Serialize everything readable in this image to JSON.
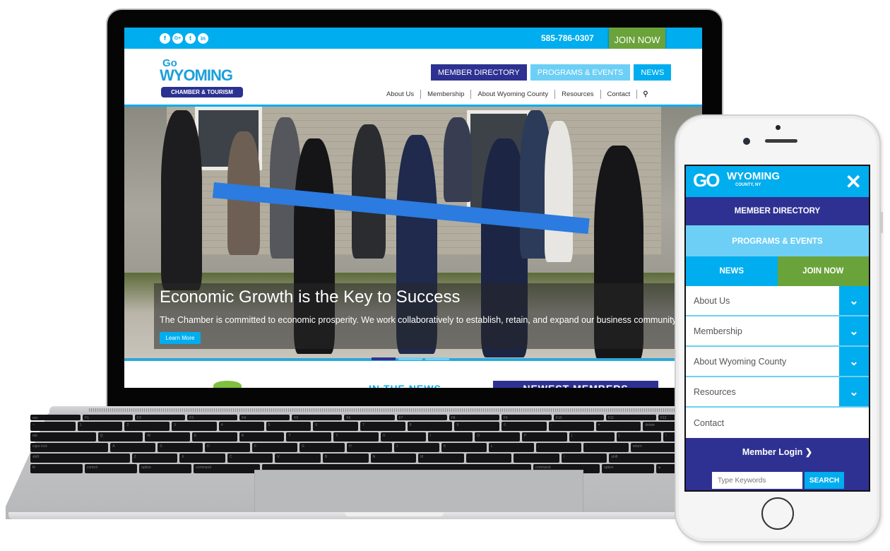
{
  "desktop": {
    "topbar": {
      "social": [
        {
          "icon": "facebook-icon",
          "glyph": "f"
        },
        {
          "icon": "google-plus-icon",
          "glyph": "G+"
        },
        {
          "icon": "twitter-icon",
          "glyph": "t"
        },
        {
          "icon": "linkedin-icon",
          "glyph": "in"
        }
      ],
      "phone": "585-786-0307",
      "join_label": "JOIN NOW"
    },
    "logo": {
      "go": "Go",
      "wyoming": "WYOMING",
      "tagline": "CHAMBER & TOURISM"
    },
    "pill_nav": [
      "MEMBER DIRECTORY",
      "PROGRAMS & EVENTS",
      "NEWS"
    ],
    "main_nav": [
      "About Us",
      "Membership",
      "About Wyoming County",
      "Resources",
      "Contact"
    ],
    "search_icon": "⚲",
    "hero": {
      "title": "Economic Growth is the Key to Success",
      "text": "The Chamber is committed to economic prosperity. We work collaboratively to establish, retain, and expand our business community",
      "button": "Learn More",
      "active_slide": 1,
      "slide_count": 3
    },
    "lower": {
      "news_heading": "IN THE NEWS",
      "members_heading": "NEWEST MEMBERS"
    }
  },
  "mobile": {
    "logo": {
      "go": "GO",
      "wyoming": "WYOMING",
      "sub": "COUNTY, NY"
    },
    "close_icon": "✕",
    "buttons": {
      "member_directory": "MEMBER DIRECTORY",
      "programs": "PROGRAMS & EVENTS",
      "news": "NEWS",
      "join": "JOIN NOW"
    },
    "menu": [
      {
        "label": "About Us",
        "expandable": true
      },
      {
        "label": "Membership",
        "expandable": true
      },
      {
        "label": "About Wyoming County",
        "expandable": true
      },
      {
        "label": "Resources",
        "expandable": true
      },
      {
        "label": "Contact",
        "expandable": false
      }
    ],
    "chevron": "⌄",
    "login_label": "Member Login ❯",
    "search": {
      "placeholder": "Type Keywords",
      "button": "SEARCH"
    }
  },
  "keyboard": {
    "rows": [
      [
        "esc",
        "F1",
        "F2",
        "F3",
        "F4",
        "F5",
        "F6",
        "F7",
        "F8",
        "F9",
        "F10",
        "F11",
        "F12"
      ],
      [
        "~",
        "1",
        "2",
        "3",
        "4",
        "5",
        "6",
        "7",
        "8",
        "9",
        "0",
        "-",
        "=",
        "delete"
      ],
      [
        "tab",
        "Q",
        "W",
        "E",
        "R",
        "T",
        "Y",
        "U",
        "I",
        "O",
        "P",
        "[",
        "]",
        "\\"
      ],
      [
        "caps lock",
        "A",
        "S",
        "D",
        "F",
        "G",
        "H",
        "J",
        "K",
        "L",
        ";",
        "'",
        "return"
      ],
      [
        "shift",
        "Z",
        "X",
        "C",
        "V",
        "B",
        "N",
        "M",
        ",",
        ".",
        "/",
        "shift"
      ],
      [
        "fn",
        "control",
        "option",
        "command",
        " ",
        "command",
        "option",
        "◂"
      ]
    ]
  }
}
